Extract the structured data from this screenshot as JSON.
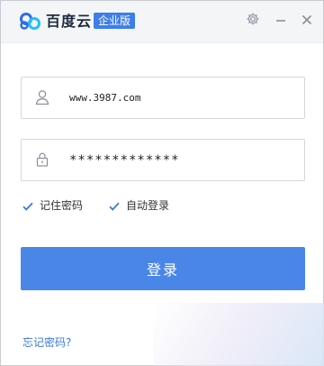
{
  "titlebar": {
    "app_name": "百度云",
    "edition_badge": "企业版",
    "icons": {
      "logo": "baidu-cloud-logo",
      "settings": "gear-icon",
      "minimize": "minimize-icon",
      "close": "close-icon"
    }
  },
  "login_form": {
    "username": {
      "value": "www.3987.com",
      "icon": "user-icon"
    },
    "password": {
      "value": "*************",
      "icon": "lock-icon"
    },
    "remember_password": {
      "label": "记住密码",
      "checked": true
    },
    "auto_login": {
      "label": "自动登录",
      "checked": true
    },
    "submit_label": "登录",
    "forgot_password_link": "忘记密码?"
  },
  "colors": {
    "accent": "#4a86e8",
    "link": "#3a7ae0",
    "badge": "#3d7eea",
    "titlebar_bg": "#f4f5f7"
  }
}
